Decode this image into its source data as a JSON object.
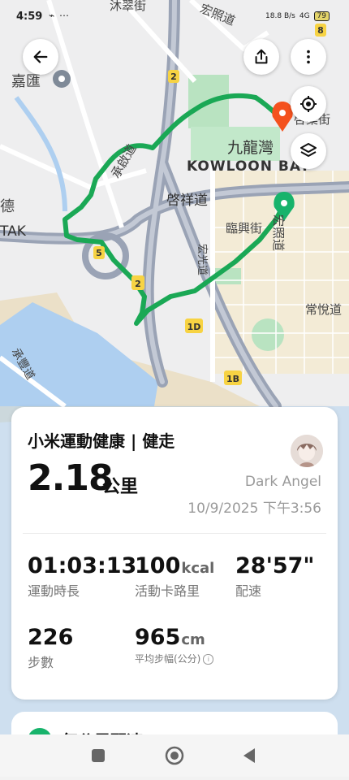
{
  "status": {
    "time": "4:59",
    "icons": "⌁ ⋯",
    "net_speed": "18.8 B/s",
    "signal": "4G",
    "battery": "79"
  },
  "map": {
    "labels": [
      "沐翠街",
      "宏照道",
      "嘉匯",
      "承啟道",
      "九龍灣",
      "KOWLOON BAY",
      "啓祥道",
      "德",
      "TAK",
      "宏光道",
      "臨興街",
      "宏照道",
      "常悅道",
      "承豐道",
      "啓業街"
    ],
    "road_badges": [
      "8",
      "2",
      "5",
      "2",
      "1D",
      "1B"
    ],
    "route_color": "#1aa855",
    "start_pin_color": "#17b36b",
    "end_pin_color": "#f4511e"
  },
  "buttons": {
    "back": "back-arrow-icon",
    "share": "share-icon",
    "more": "more-vertical-icon",
    "locate": "locate-icon",
    "layers": "layers-icon"
  },
  "summary": {
    "app_title": "小米運動健康 | 健走",
    "distance": "2.18",
    "distance_unit": "公里",
    "username": "Dark Angel",
    "datetime": "10/9/2025 下午3:56"
  },
  "stats": [
    {
      "value": "01:03:13",
      "unit": "",
      "label": "運動時長"
    },
    {
      "value": "100",
      "unit": "kcal",
      "label": "活動卡路里"
    },
    {
      "value": "28'57\"",
      "unit": "",
      "label": "配速"
    },
    {
      "value": "226",
      "unit": "",
      "label": "步數"
    },
    {
      "value": "965",
      "unit": "cm",
      "label": "平均步幅(公分)"
    }
  ],
  "next_card": {
    "title": "每公里配速"
  }
}
